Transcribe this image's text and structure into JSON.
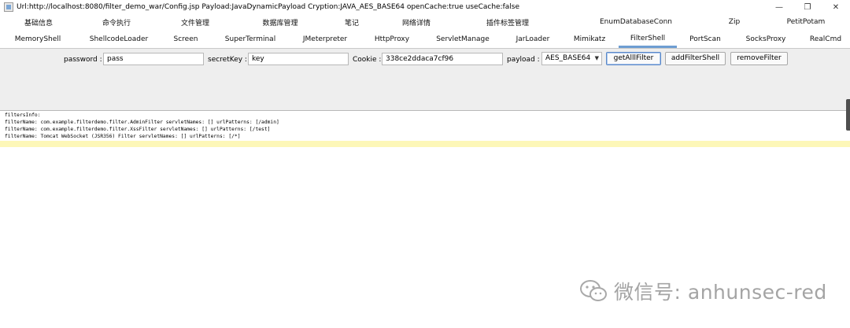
{
  "window": {
    "title": "Url:http://localhost:8080/filter_demo_war/Config.jsp Payload:JavaDynamicPayload Cryption:JAVA_AES_BASE64 openCache:true useCache:false",
    "controls": {
      "minimize": "—",
      "restore": "❐",
      "close": "✕"
    }
  },
  "tabs_row1": [
    "基础信息",
    "命令执行",
    "文件管理",
    "数据库管理",
    "笔记",
    "网络详情",
    "插件标签管理",
    "EnumDatabaseConn",
    "Zip",
    "PetitPotam"
  ],
  "tabs_row2": [
    "MemoryShell",
    "ShellcodeLoader",
    "Screen",
    "SuperTerminal",
    "JMeterpreter",
    "HttpProxy",
    "ServletManage",
    "JarLoader",
    "Mimikatz",
    "FilterShell",
    "PortScan",
    "SocksProxy",
    "RealCmd"
  ],
  "selected_tab": "FilterShell",
  "form": {
    "password_label": "password :",
    "password_value": "pass",
    "secretkey_label": "secretKey :",
    "secretkey_value": "key",
    "cookie_label": "Cookie :",
    "cookie_value": "338ce2ddaca7cf96",
    "payload_label": "payload :",
    "payload_value": "AES_BASE64",
    "btn_get": "getAlllFilter",
    "btn_add": "addFilterShell",
    "btn_remove": "removeFilter"
  },
  "output_lines": [
    "filtersInfo:",
    "filterName: com.example.filterdemo.filter.AdminFilter servletNames: [] urlPatterns: [/admin]",
    "filterName: com.example.filterdemo.filter.XssFilter servletNames: [] urlPatterns: [/test]",
    "filterName: Tomcat WebSocket (JSR356) Filter servletNames: [] urlPatterns: [/*]"
  ],
  "watermark": {
    "text": "微信号: anhunsec-red",
    "icon": "wechat-icon"
  }
}
